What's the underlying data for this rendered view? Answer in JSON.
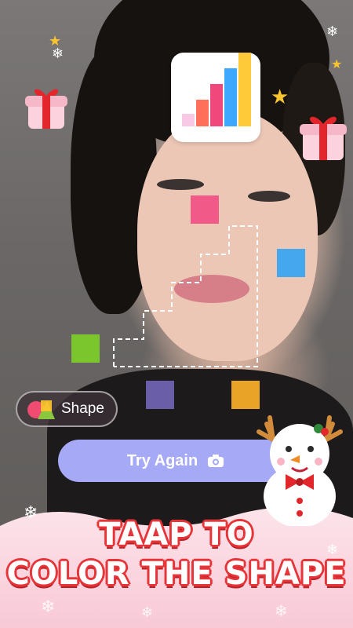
{
  "top_icon": "bar-chart-icon",
  "shape_button": {
    "label": "Shape",
    "icon": "shapes-icon"
  },
  "try_again": {
    "label": "Try Again",
    "icon": "camera-icon"
  },
  "title": {
    "line1": "TAAP TO",
    "line2": "COLOR THE SHAPE"
  },
  "colors": {
    "pink": "#f15a88",
    "blue": "#45a8ee",
    "green": "#7bc62d",
    "purple": "#6b5ea8",
    "orange": "#e9a326",
    "accent_red": "#e73438",
    "button_purple": "#a5a9f6"
  },
  "decorations": [
    "gift-icon",
    "star-icon",
    "snowflake-icon",
    "snowman-icon"
  ]
}
